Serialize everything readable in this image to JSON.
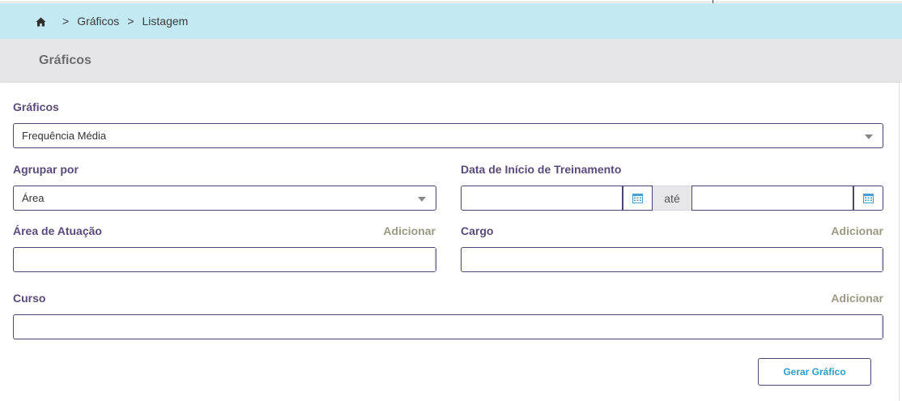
{
  "breadcrumb": {
    "home_icon": "home-icon",
    "separator": ">",
    "items": [
      "Gráficos",
      "Listagem"
    ]
  },
  "page_title": "Gráficos",
  "form": {
    "graficos": {
      "label": "Gráficos",
      "selected": "Frequência Média"
    },
    "agrupar_por": {
      "label": "Agrupar por",
      "selected": "Área"
    },
    "data_inicio": {
      "label": "Data de Início de Treinamento",
      "separator": "até",
      "start_value": "",
      "end_value": ""
    },
    "area_atuacao": {
      "label": "Área de Atuação",
      "add_label": "Adicionar",
      "value": ""
    },
    "cargo": {
      "label": "Cargo",
      "add_label": "Adicionar",
      "value": ""
    },
    "curso": {
      "label": "Curso",
      "add_label": "Adicionar",
      "value": ""
    }
  },
  "actions": {
    "generate_label": "Gerar Gráfico"
  },
  "colors": {
    "breadcrumb_bg": "#c3e9f3",
    "title_bg": "#e6e6e8",
    "label_color": "#5a4a7a",
    "border_color": "#4d4470",
    "button_text": "#2e9dc7"
  }
}
